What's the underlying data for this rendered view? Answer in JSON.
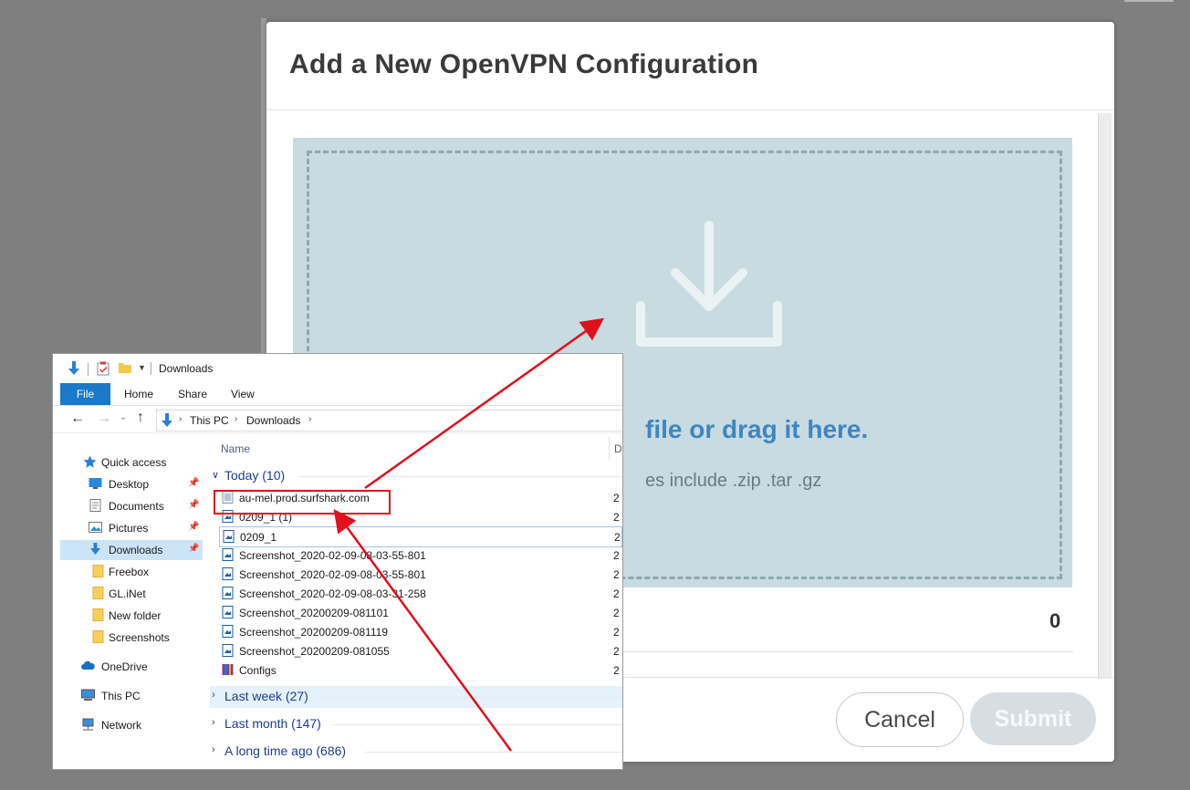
{
  "modal": {
    "title": "Add a New OpenVPN Configuration",
    "drop_text": "file or drag it here.",
    "drop_subtext": "es include .zip .tar .gz",
    "count": "0",
    "cancel_label": "Cancel",
    "submit_label": "Submit"
  },
  "explorer": {
    "title": "Downloads",
    "ribbon_tabs": [
      "File",
      "Home",
      "Share",
      "View"
    ],
    "breadcrumb": [
      "This PC",
      "Downloads"
    ],
    "nav": [
      {
        "label": "Quick access",
        "icon": "star-icon"
      },
      {
        "label": "Desktop",
        "icon": "desktop-icon",
        "pinned": true
      },
      {
        "label": "Documents",
        "icon": "documents-icon",
        "pinned": true
      },
      {
        "label": "Pictures",
        "icon": "pictures-icon",
        "pinned": true
      },
      {
        "label": "Downloads",
        "icon": "download-icon",
        "pinned": true,
        "selected": true
      },
      {
        "label": "Freebox",
        "icon": "folder-icon"
      },
      {
        "label": "GL.iNet",
        "icon": "folder-icon"
      },
      {
        "label": "New folder",
        "icon": "folder-icon"
      },
      {
        "label": "Screenshots",
        "icon": "folder-icon"
      },
      {
        "label": "OneDrive",
        "icon": "cloud-icon"
      },
      {
        "label": "This PC",
        "icon": "computer-icon"
      },
      {
        "label": "Network",
        "icon": "network-icon"
      }
    ],
    "column_name": "Name",
    "column_date_partial": "D",
    "groups": {
      "today": "Today (10)",
      "last_week": "Last week (27)",
      "last_month": "Last month (147)",
      "long_ago": "A long time ago (686)"
    },
    "files": [
      {
        "name": "au-mel.prod.surfshark.com",
        "icon": "config-file-icon",
        "date": "2"
      },
      {
        "name": "0209_1 (1)",
        "icon": "image-file-icon",
        "date": "2"
      },
      {
        "name": "0209_1",
        "icon": "image-file-icon",
        "date": "2"
      },
      {
        "name": "Screenshot_2020-02-09-08-03-55-801",
        "icon": "image-file-icon",
        "date": "2"
      },
      {
        "name": "Screenshot_2020-02-09-08-03-55-801",
        "icon": "image-file-icon",
        "date": "2"
      },
      {
        "name": "Screenshot_2020-02-09-08-03-31-258",
        "icon": "image-file-icon",
        "date": "2"
      },
      {
        "name": "Screenshot_20200209-081101",
        "icon": "image-file-icon",
        "date": "2"
      },
      {
        "name": "Screenshot_20200209-081119",
        "icon": "image-file-icon",
        "date": "2"
      },
      {
        "name": "Screenshot_20200209-081055",
        "icon": "image-file-icon",
        "date": "2"
      },
      {
        "name": "Configs",
        "icon": "archive-icon",
        "date": "2"
      }
    ]
  },
  "colors": {
    "accent_blue": "#3f86c0",
    "highlight_red": "#e0101d",
    "dropzone_bg": "#c8dbe1",
    "file_tab": "#1979ca"
  }
}
